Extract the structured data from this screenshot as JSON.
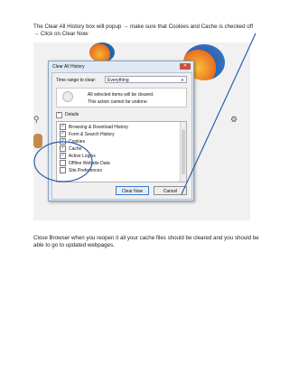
{
  "instruction_top": "The Clear All History box will popup → make sure that Cookies and Cache is checked off → Click on Clear Now",
  "instruction_bottom": "Close Browser when you reopen it all your cache files should be cleared and you should be able to go to updated webpages.",
  "dialog": {
    "title": "Clear All History",
    "close_glyph": "✕",
    "time_range_label": "Time range to clear:",
    "time_range_value": "Everything",
    "warning_line1": "All selected items will be cleared.",
    "warning_line2": "This action cannot be undone.",
    "details_label": "Details",
    "items": [
      {
        "label": "Browsing & Download History",
        "checked": true
      },
      {
        "label": "Form & Search History",
        "checked": true
      },
      {
        "label": "Cookies",
        "checked": true
      },
      {
        "label": "Cache",
        "checked": true
      },
      {
        "label": "Active Logins",
        "checked": true
      },
      {
        "label": "Offline Website Data",
        "checked": false
      },
      {
        "label": "Site Preferences",
        "checked": false
      }
    ],
    "clear_now_label": "Clear Now",
    "cancel_label": "Cancel"
  },
  "icons": {
    "search": "magnifier-icon",
    "gear": "gear-icon",
    "warning": "warning-icon"
  },
  "colors": {
    "annotation": "#2d5faa",
    "dialog_bg": "#dfe9f5",
    "focus_border": "#3a7bd5"
  }
}
